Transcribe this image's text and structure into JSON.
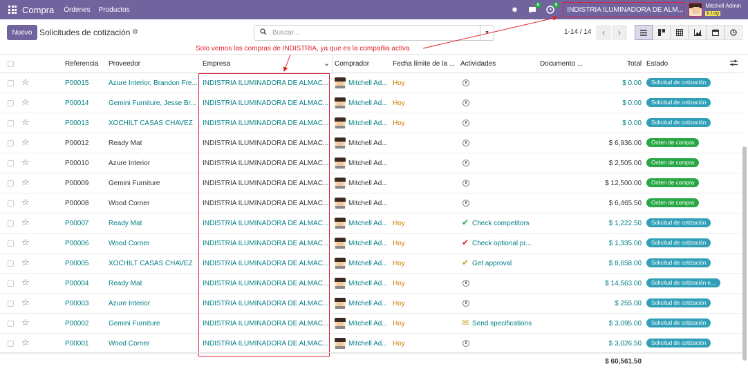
{
  "navbar": {
    "app_name": "Compra",
    "menus": [
      "Órdenes",
      "Productos"
    ],
    "badges": {
      "messages": "8",
      "activities": "9"
    },
    "company": "INDISTRIA ILUMINADORA DE ALM...",
    "user_name": "Mitchell Admin",
    "user_db": "b Log"
  },
  "control": {
    "new_label": "Nuevo",
    "title": "Solicitudes de cotización",
    "search_placeholder": "Buscar...",
    "pager": "1-14 / 14"
  },
  "annotation": "Solo vemos las compras de INDISTRIA, ya que es la compañia activa",
  "columns": {
    "referencia": "Referencia",
    "proveedor": "Proveedor",
    "empresa": "Empresa",
    "comprador": "Comprador",
    "fecha": "Fecha límite de la ...",
    "actividades": "Actividades",
    "documento": "Documento ...",
    "total": "Total",
    "estado": "Estado"
  },
  "rows": [
    {
      "ref": "P00015",
      "vendor": "Azure Interior, Brandon Fre...",
      "company": "INDISTRIA ILUMINADORA DE ALMAC...",
      "buyer": "Mitchell Ad...",
      "deadline": "Hoy",
      "activity": "",
      "total": "$ 0.00",
      "state": "Solicitud de cotización"
    },
    {
      "ref": "P00014",
      "vendor": "Gemini Furniture, Jesse Br...",
      "company": "INDISTRIA ILUMINADORA DE ALMAC...",
      "buyer": "Mitchell Ad...",
      "deadline": "Hoy",
      "activity": "",
      "total": "$ 0.00",
      "state": "Solicitud de cotización"
    },
    {
      "ref": "P00013",
      "vendor": "XOCHILT CASAS CHAVEZ",
      "company": "INDISTRIA ILUMINADORA DE ALMAC...",
      "buyer": "Mitchell Ad...",
      "deadline": "Hoy",
      "activity": "",
      "total": "$ 0.00",
      "state": "Solicitud de cotización"
    },
    {
      "ref": "P00012",
      "vendor": "Ready Mat",
      "company": "INDISTRIA ILUMINADORA DE ALMAC...",
      "buyer": "Mitchell Ad...",
      "deadline": "",
      "activity": "",
      "total": "$ 6,936.00",
      "state": "Orden de compra"
    },
    {
      "ref": "P00010",
      "vendor": "Azure Interior",
      "company": "INDISTRIA ILUMINADORA DE ALMAC...",
      "buyer": "Mitchell Ad...",
      "deadline": "",
      "activity": "",
      "total": "$ 2,505.00",
      "state": "Orden de compra"
    },
    {
      "ref": "P00009",
      "vendor": "Gemini Furniture",
      "company": "INDISTRIA ILUMINADORA DE ALMAC...",
      "buyer": "Mitchell Ad...",
      "deadline": "",
      "activity": "",
      "total": "$ 12,500.00",
      "state": "Orden de compra"
    },
    {
      "ref": "P00008",
      "vendor": "Wood Corner",
      "company": "INDISTRIA ILUMINADORA DE ALMAC...",
      "buyer": "Mitchell Ad...",
      "deadline": "",
      "activity": "",
      "total": "$ 6,465.50",
      "state": "Orden de compra"
    },
    {
      "ref": "P00007",
      "vendor": "Ready Mat",
      "company": "INDISTRIA ILUMINADORA DE ALMAC...",
      "buyer": "Mitchell Ad...",
      "deadline": "Hoy",
      "activity": "Check competitors",
      "total": "$ 1,222.50",
      "state": "Solicitud de cotización"
    },
    {
      "ref": "P00006",
      "vendor": "Wood Corner",
      "company": "INDISTRIA ILUMINADORA DE ALMAC...",
      "buyer": "Mitchell Ad...",
      "deadline": "Hoy",
      "activity": "Check optional pr...",
      "total": "$ 1,335.00",
      "state": "Solicitud de cotización"
    },
    {
      "ref": "P00005",
      "vendor": "XOCHILT CASAS CHAVEZ",
      "company": "INDISTRIA ILUMINADORA DE ALMAC...",
      "buyer": "Mitchell Ad...",
      "deadline": "Hoy",
      "activity": "Get approval",
      "total": "$ 8,658.00",
      "state": "Solicitud de cotización"
    },
    {
      "ref": "P00004",
      "vendor": "Ready Mat",
      "company": "INDISTRIA ILUMINADORA DE ALMAC...",
      "buyer": "Mitchell Ad...",
      "deadline": "Hoy",
      "activity": "",
      "total": "$ 14,563.00",
      "state": "Solicitud de cotización e..."
    },
    {
      "ref": "P00003",
      "vendor": "Azure Interior",
      "company": "INDISTRIA ILUMINADORA DE ALMAC...",
      "buyer": "Mitchell Ad...",
      "deadline": "Hoy",
      "activity": "",
      "total": "$ 255.00",
      "state": "Solicitud de cotización"
    },
    {
      "ref": "P00002",
      "vendor": "Gemini Furniture",
      "company": "INDISTRIA ILUMINADORA DE ALMAC...",
      "buyer": "Mitchell Ad...",
      "deadline": "Hoy",
      "activity": "Send specifications",
      "total": "$ 3,095.00",
      "state": "Solicitud de cotización"
    },
    {
      "ref": "P00001",
      "vendor": "Wood Corner",
      "company": "INDISTRIA ILUMINADORA DE ALMAC...",
      "buyer": "Mitchell Ad...",
      "deadline": "Hoy",
      "activity": "",
      "total": "$ 3,026.50",
      "state": "Solicitud de cotización"
    }
  ],
  "footer_total": "$ 60,561.50",
  "colors": {
    "brand": "#71639e",
    "link": "#017e84",
    "warning": "#d17f00",
    "state_rfq": "#30a0b8",
    "state_po": "#28a745",
    "annotation": "#e0222b"
  }
}
